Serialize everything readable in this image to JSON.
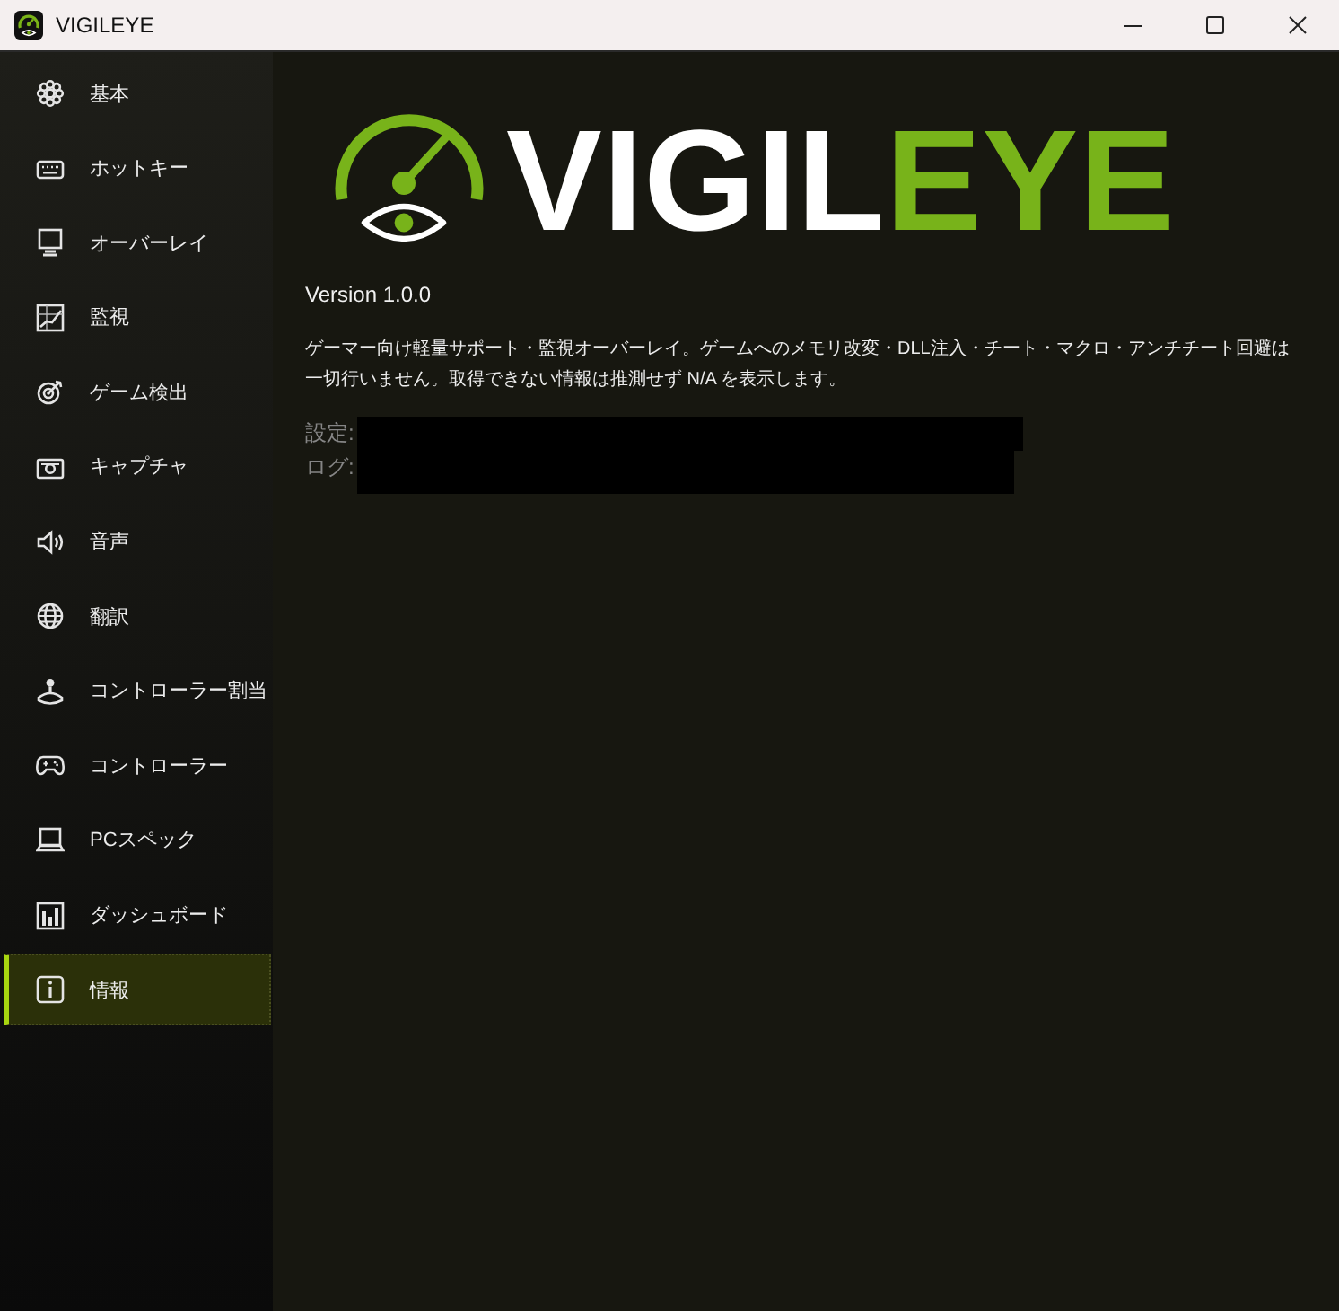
{
  "window": {
    "title": "VIGILEYE"
  },
  "sidebar": {
    "items": [
      {
        "label": "基本",
        "selected": false
      },
      {
        "label": "ホットキー",
        "selected": false
      },
      {
        "label": "オーバーレイ",
        "selected": false
      },
      {
        "label": "監視",
        "selected": false
      },
      {
        "label": "ゲーム検出",
        "selected": false
      },
      {
        "label": "キャプチャ",
        "selected": false
      },
      {
        "label": "音声",
        "selected": false
      },
      {
        "label": "翻訳",
        "selected": false
      },
      {
        "label": "コントローラー割当",
        "selected": false
      },
      {
        "label": "コントローラー",
        "selected": false
      },
      {
        "label": "PCスペック",
        "selected": false
      },
      {
        "label": "ダッシュボード",
        "selected": false
      },
      {
        "label": "情報",
        "selected": true
      }
    ]
  },
  "about": {
    "logo": {
      "text": "VIGIL",
      "accent_text": "EYE"
    },
    "version": "Version 1.0.0",
    "description": "ゲーマー向け軽量サポート・監視オーバーレイ。ゲームへのメモリ改変・DLL注入・チート・マクロ・アンチチート回避は一切行いません。取得できない情報は推測せず N/A を表示します。",
    "paths": [
      {
        "label": "設定:",
        "redacted": true
      },
      {
        "label": "ログ:",
        "redacted": true
      }
    ]
  }
}
